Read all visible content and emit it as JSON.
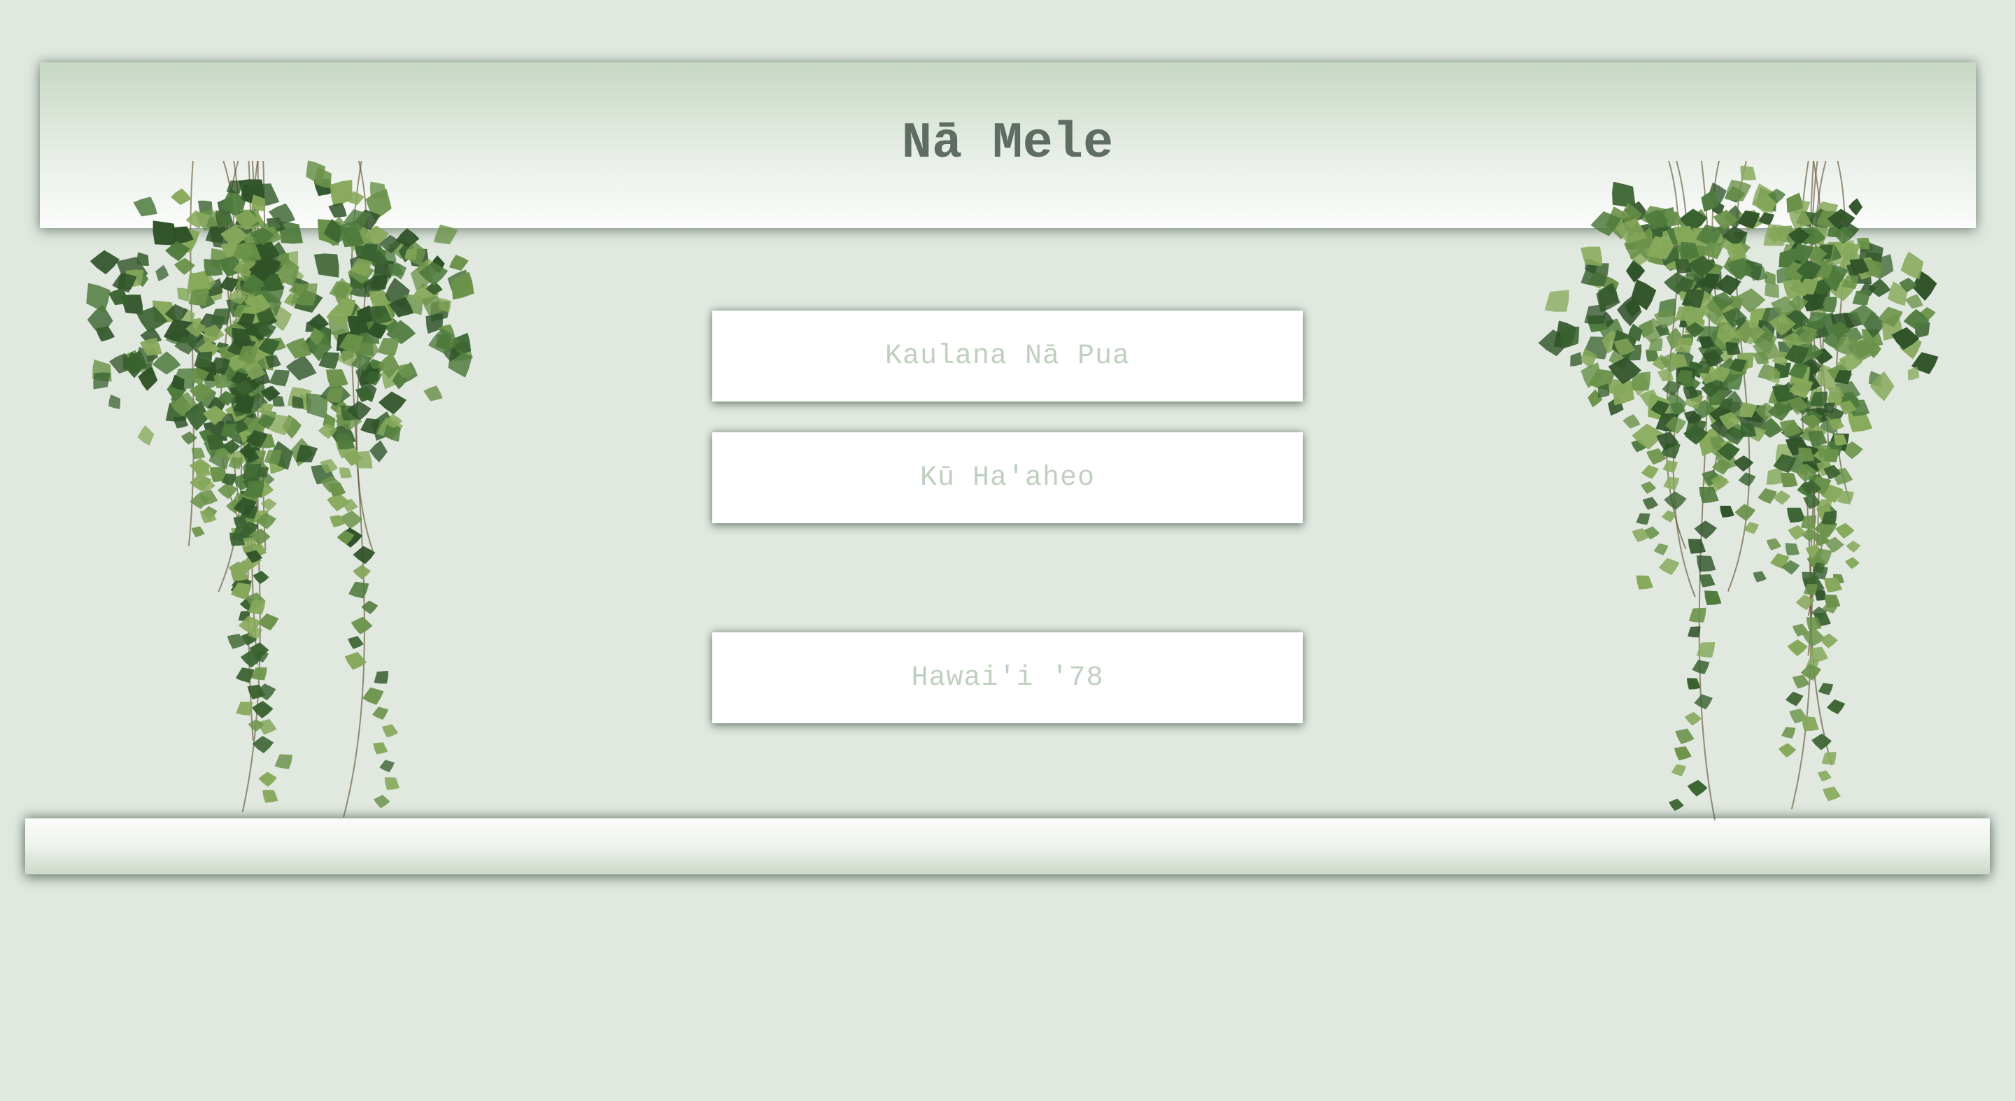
{
  "header": {
    "title": "Nā Mele"
  },
  "songs": [
    {
      "label": "Kaulana Nā Pua"
    },
    {
      "label": "Kū Ha'aheo"
    },
    {
      "label": "Hawai'i '78"
    }
  ],
  "decorations": {
    "left": "hanging-ivy-plant",
    "right": "hanging-ivy-plant"
  },
  "colors": {
    "background": "#e0e8e0",
    "title": "#5e6c64",
    "button_text": "#bfd0bf",
    "leaf_dark": "#2f5228",
    "leaf_mid": "#4e7a3c",
    "leaf_light": "#86a85a"
  }
}
